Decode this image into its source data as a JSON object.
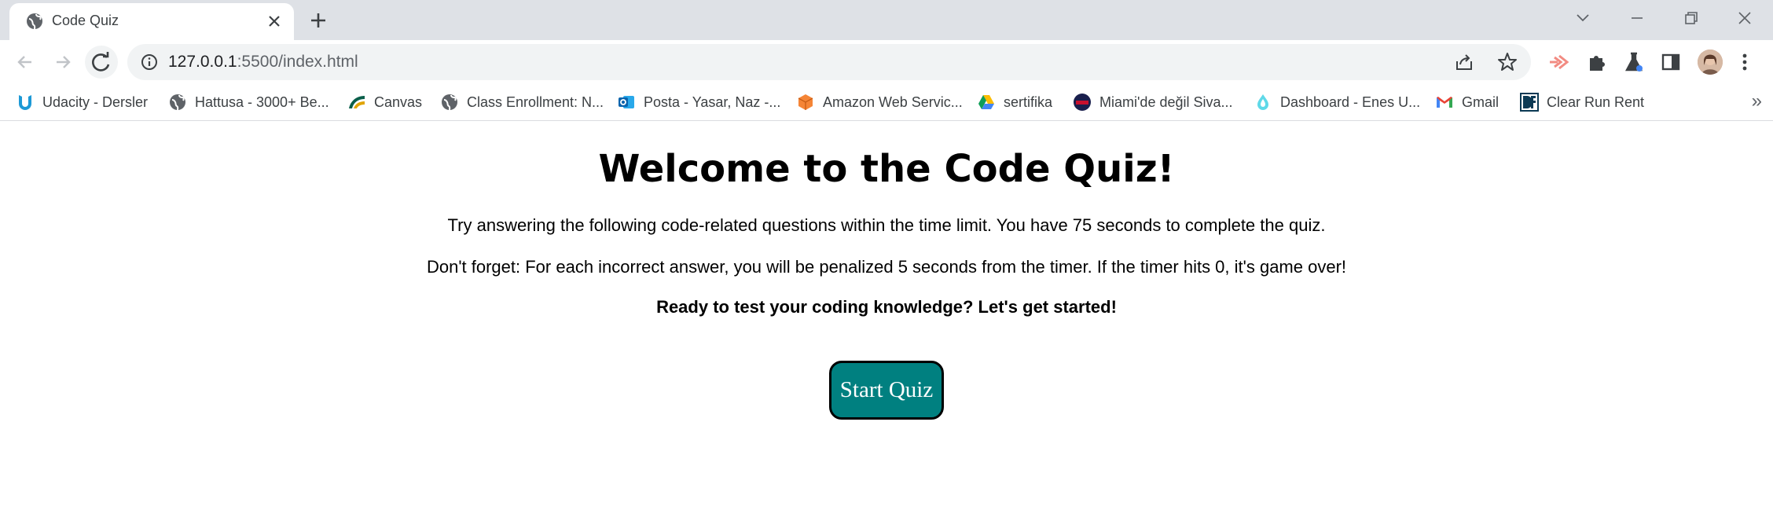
{
  "tab": {
    "title": "Code Quiz"
  },
  "address_bar": {
    "host": "127.0.0.1",
    "path": ":5500/index.html"
  },
  "bookmarks": [
    {
      "label": "Udacity - Dersler",
      "icon": "udacity-icon"
    },
    {
      "label": "Hattusa - 3000+ Be...",
      "icon": "globe-icon"
    },
    {
      "label": "Canvas",
      "icon": "canvas-icon"
    },
    {
      "label": "Class Enrollment: N...",
      "icon": "globe-icon"
    },
    {
      "label": "Posta - Yasar, Naz -...",
      "icon": "outlook-icon"
    },
    {
      "label": "Amazon Web Servic...",
      "icon": "aws-icon"
    },
    {
      "label": "sertifika",
      "icon": "google-drive-icon"
    },
    {
      "label": "Miami'de değil Siva...",
      "icon": "badge-icon"
    },
    {
      "label": "Dashboard - Enes U...",
      "icon": "drop-icon"
    },
    {
      "label": "Gmail",
      "icon": "gmail-icon"
    },
    {
      "label": "Clear Run Rent",
      "icon": "dl-icon"
    }
  ],
  "bookmarks_overflow": "»",
  "page": {
    "heading": "Welcome to the Code Quiz!",
    "intro": "Try answering the following code-related questions within the time limit. You have 75 seconds to complete the quiz.",
    "warning": "Don't forget: For each incorrect answer, you will be penalized 5 seconds from the timer. If the timer hits 0, it's game over!",
    "cta": "Ready to test your coding knowledge? Let's get started!",
    "start_button": "Start Quiz"
  },
  "colors": {
    "start_button_bg": "#008080",
    "tabstrip_bg": "#dee1e6",
    "omnibox_bg": "#f1f3f4"
  }
}
